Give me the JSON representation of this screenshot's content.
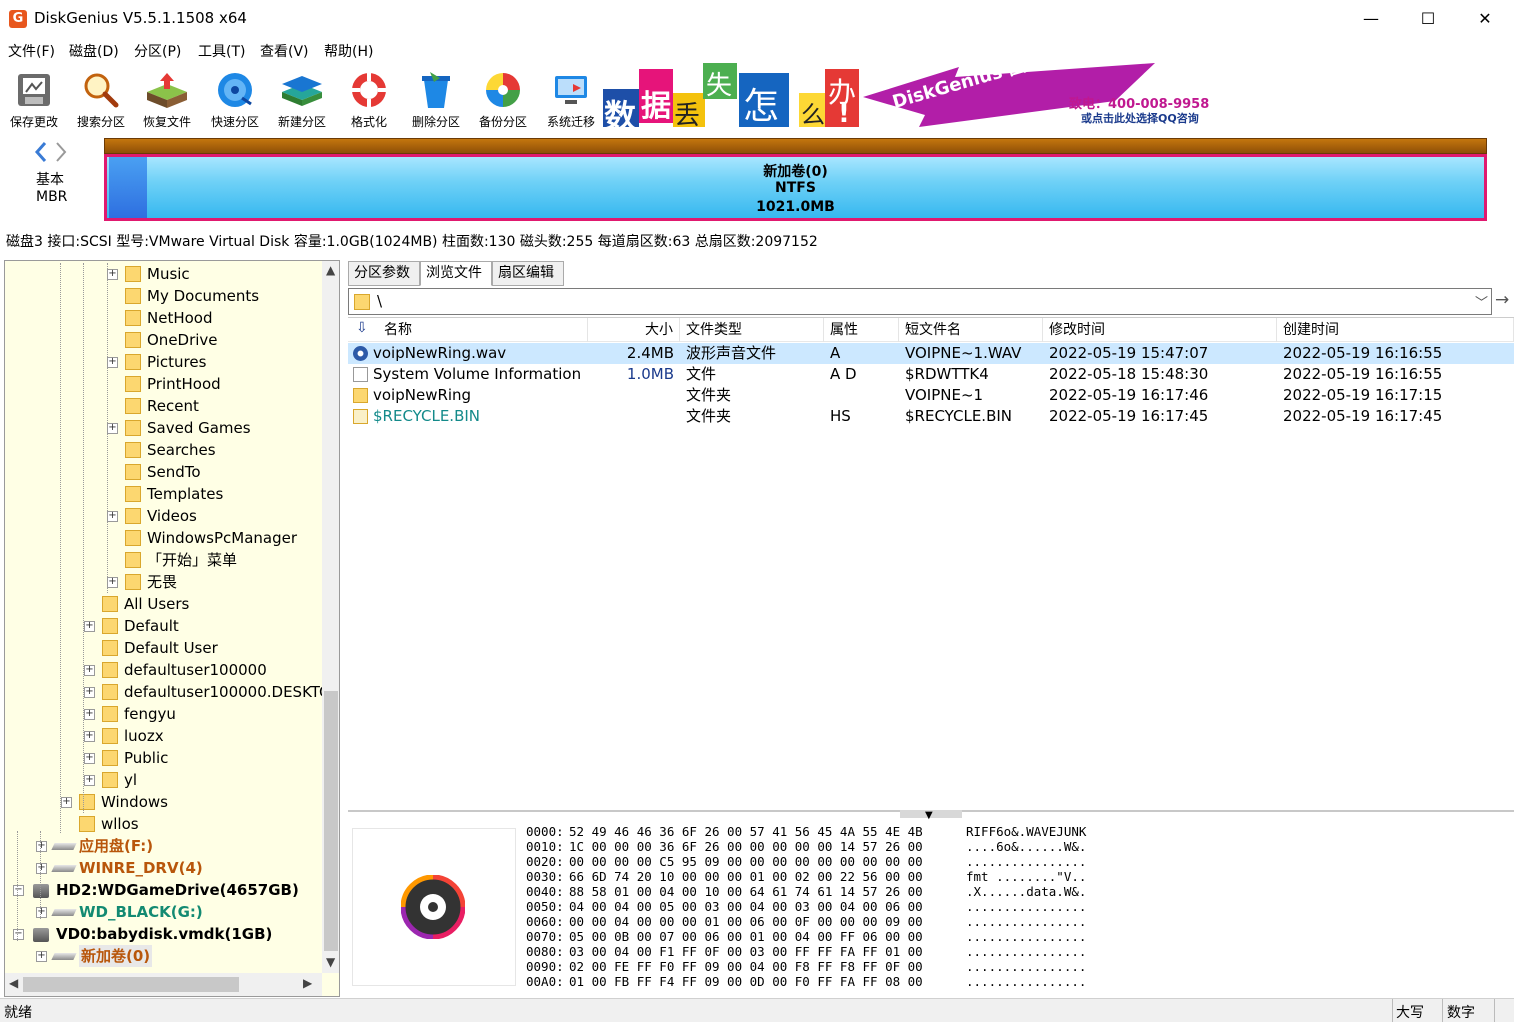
{
  "window": {
    "title": "DiskGenius V5.5.1.1508 x64",
    "minimize": "—",
    "maximize": "☐",
    "close": "✕"
  },
  "menu": [
    "文件(F)",
    "磁盘(D)",
    "分区(P)",
    "工具(T)",
    "查看(V)",
    "帮助(H)"
  ],
  "toolbar": [
    {
      "label": "保存更改",
      "icon": "save-icon"
    },
    {
      "label": "搜索分区",
      "icon": "search-icon"
    },
    {
      "label": "恢复文件",
      "icon": "recover-icon"
    },
    {
      "label": "快速分区",
      "icon": "quick-partition-icon"
    },
    {
      "label": "新建分区",
      "icon": "new-partition-icon"
    },
    {
      "label": "格式化",
      "icon": "format-icon"
    },
    {
      "label": "删除分区",
      "icon": "delete-icon"
    },
    {
      "label": "备份分区",
      "icon": "backup-icon"
    },
    {
      "label": "系统迁移",
      "icon": "migrate-icon"
    }
  ],
  "banner": {
    "chars": [
      "数",
      "据",
      "丢",
      "失",
      "怎",
      "么",
      "办",
      "!"
    ],
    "slogan": "DiskGenius 团队为您服务",
    "phone": "致电：400-008-9958",
    "qq": "或点击此处选择QQ咨询"
  },
  "diskmap": {
    "type1": "基本",
    "type2": "MBR",
    "partition_name": "新加卷(0)",
    "partition_fs": "NTFS",
    "partition_size": "1021.0MB"
  },
  "diskinfo": "磁盘3 接口:SCSI  型号:VMware Virtual Disk  容量:1.0GB(1024MB)  柱面数:130  磁头数:255  每道扇区数:63  总扇区数:2097152",
  "tree": [
    {
      "label": "Music",
      "indent": 4,
      "expander": true
    },
    {
      "label": "My Documents",
      "indent": 4,
      "expander": false
    },
    {
      "label": "NetHood",
      "indent": 4,
      "expander": false
    },
    {
      "label": "OneDrive",
      "indent": 4,
      "expander": false
    },
    {
      "label": "Pictures",
      "indent": 4,
      "expander": true
    },
    {
      "label": "PrintHood",
      "indent": 4,
      "expander": false
    },
    {
      "label": "Recent",
      "indent": 4,
      "expander": false
    },
    {
      "label": "Saved Games",
      "indent": 4,
      "expander": true
    },
    {
      "label": "Searches",
      "indent": 4,
      "expander": false
    },
    {
      "label": "SendTo",
      "indent": 4,
      "expander": false
    },
    {
      "label": "Templates",
      "indent": 4,
      "expander": false
    },
    {
      "label": "Videos",
      "indent": 4,
      "expander": true
    },
    {
      "label": "WindowsPcManager",
      "indent": 4,
      "expander": false
    },
    {
      "label": "「开始」菜单",
      "indent": 4,
      "expander": false
    },
    {
      "label": "无畏",
      "indent": 4,
      "expander": true
    },
    {
      "label": "All Users",
      "indent": 3,
      "expander": false
    },
    {
      "label": "Default",
      "indent": 3,
      "expander": true
    },
    {
      "label": "Default User",
      "indent": 3,
      "expander": false
    },
    {
      "label": "defaultuser100000",
      "indent": 3,
      "expander": true
    },
    {
      "label": "defaultuser100000.DESKTC",
      "indent": 3,
      "expander": true
    },
    {
      "label": "fengyu",
      "indent": 3,
      "expander": true
    },
    {
      "label": "luozx",
      "indent": 3,
      "expander": true
    },
    {
      "label": "Public",
      "indent": 3,
      "expander": true
    },
    {
      "label": "yl",
      "indent": 3,
      "expander": true
    },
    {
      "label": "Windows",
      "indent": 2,
      "expander": true
    },
    {
      "label": "wllos",
      "indent": 2,
      "expander": false
    }
  ],
  "tree_drives": [
    {
      "label": "应用盘(F:)",
      "color": "#b8560b",
      "kind": "partition"
    },
    {
      "label": "WINRE_DRV(4)",
      "color": "#b8560b",
      "kind": "partition"
    },
    {
      "label": "HD2:WDGameDrive(4657GB)",
      "color": "#000000",
      "kind": "disk"
    },
    {
      "label": "WD_BLACK(G:)",
      "color": "#138a72",
      "kind": "partition"
    },
    {
      "label": "VD0:babydisk.vmdk(1GB)",
      "color": "#000000",
      "kind": "disk"
    },
    {
      "label": "新加卷(0)",
      "color": "#b8560b",
      "kind": "partition-selected"
    }
  ],
  "tabs": [
    "分区参数",
    "浏览文件",
    "扇区编辑"
  ],
  "active_tab": 1,
  "path": "\\",
  "columns": [
    "名称",
    "大小",
    "文件类型",
    "属性",
    "短文件名",
    "修改时间",
    "创建时间"
  ],
  "files": [
    {
      "name": "voipNewRing.wav",
      "size": "2.4MB",
      "type": "波形声音文件",
      "attr": "A",
      "short": "VOIPNE~1.WAV",
      "modified": "2022-05-19 15:47:07",
      "created": "2022-05-19 16:16:55",
      "icon": "audio-file-icon",
      "color": "#000000"
    },
    {
      "name": "System Volume Information",
      "size": "1.0MB",
      "type": "文件",
      "attr": "A D",
      "short": "$RDWTTK4",
      "modified": "2022-05-18 15:48:30",
      "created": "2022-05-19 16:16:55",
      "icon": "file-icon",
      "color": "#000000"
    },
    {
      "name": "voipNewRing",
      "size": "",
      "type": "文件夹",
      "attr": "",
      "short": "VOIPNE~1",
      "modified": "2022-05-19 16:17:46",
      "created": "2022-05-19 16:17:15",
      "icon": "folder-icon",
      "color": "#000000"
    },
    {
      "name": "$RECYCLE.BIN",
      "size": "",
      "type": "文件夹",
      "attr": "HS",
      "short": "$RECYCLE.BIN",
      "modified": "2022-05-19 16:17:45",
      "created": "2022-05-19 16:17:45",
      "icon": "folder-icon",
      "color": "#138a8a"
    }
  ],
  "hex": [
    {
      "offset": "0000:",
      "bytes": "52 49 46 46 36 6F 26 00 57 41 56 45 4A 55 4E 4B",
      "ascii": "RIFF6o&.WAVEJUNK"
    },
    {
      "offset": "0010:",
      "bytes": "1C 00 00 00 36 6F 26 00 00 00 00 00 14 57 26 00",
      "ascii": "....6o&......W&."
    },
    {
      "offset": "0020:",
      "bytes": "00 00 00 00 C5 95 09 00 00 00 00 00 00 00 00 00",
      "ascii": "................"
    },
    {
      "offset": "0030:",
      "bytes": "66 6D 74 20 10 00 00 00 01 00 02 00 22 56 00 00",
      "ascii": "fmt ........\"V.."
    },
    {
      "offset": "0040:",
      "bytes": "88 58 01 00 04 00 10 00 64 61 74 61 14 57 26 00",
      "ascii": ".X......data.W&."
    },
    {
      "offset": "0050:",
      "bytes": "04 00 04 00 05 00 03 00 04 00 03 00 04 00 06 00",
      "ascii": "................"
    },
    {
      "offset": "0060:",
      "bytes": "00 00 04 00 00 00 01 00 06 00 0F 00 00 00 09 00",
      "ascii": "................"
    },
    {
      "offset": "0070:",
      "bytes": "05 00 0B 00 07 00 06 00 01 00 04 00 FF 06 00 00",
      "ascii": "................"
    },
    {
      "offset": "0080:",
      "bytes": "03 00 04 00 F1 FF 0F 00 03 00 FF FF FA FF 01 00",
      "ascii": "................"
    },
    {
      "offset": "0090:",
      "bytes": "02 00 FE FF F0 FF 09 00 04 00 F8 FF F8 FF 0F 00",
      "ascii": "................"
    },
    {
      "offset": "00A0:",
      "bytes": "01 00 FB FF F4 FF 09 00 0D 00 F0 FF FA FF 08 00",
      "ascii": "................"
    }
  ],
  "status": {
    "left": "就绪",
    "caps": "大写",
    "num": "数字"
  }
}
